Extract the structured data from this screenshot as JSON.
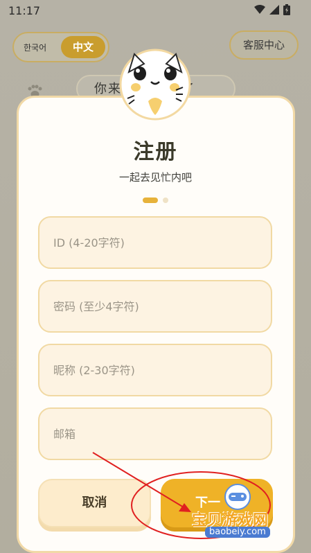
{
  "status_bar": {
    "time": "11:17",
    "icons": [
      "wifi-icon",
      "signal-icon",
      "battery-charging-icon"
    ]
  },
  "background": {
    "lang_toggle": {
      "korean_label": "한국어",
      "chinese_label": "中文"
    },
    "service_button_label": "客服中心",
    "speech_bubble_text": "你来______久了"
  },
  "modal": {
    "title": "注册",
    "subtitle": "一起去见忙内吧",
    "step_indicator": {
      "current": 1,
      "total": 2
    },
    "fields": [
      {
        "placeholder": "ID (4-20字符)",
        "value": ""
      },
      {
        "placeholder": "密码 (至少4字符)",
        "value": ""
      },
      {
        "placeholder": "昵称 (2-30字符)",
        "value": ""
      },
      {
        "placeholder": "邮箱",
        "value": ""
      }
    ],
    "cancel_label": "取消",
    "next_label": "下一"
  },
  "watermark": {
    "text": "宝贝游戏网",
    "url": "baobeiy.com"
  },
  "colors": {
    "accent": "#efb227",
    "field_bg": "#fdf3e2",
    "field_border": "#f1d9a3",
    "annotation": "#e02020"
  }
}
